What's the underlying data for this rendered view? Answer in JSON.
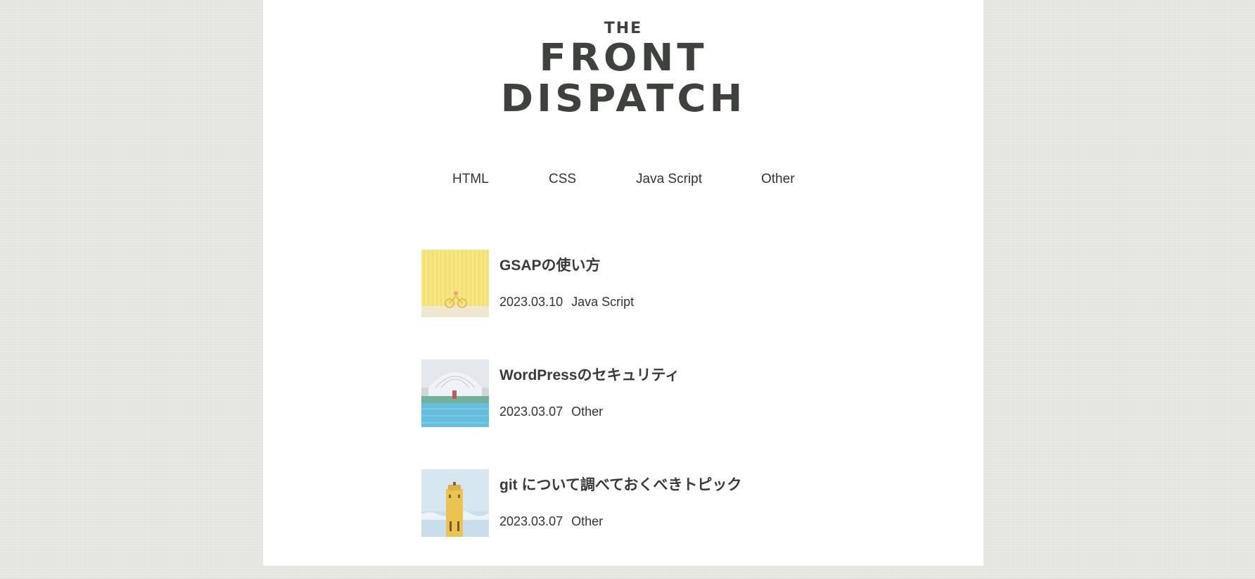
{
  "logo": {
    "the": "THE",
    "line1": "FRONT",
    "line2": "DISPATCH"
  },
  "nav": {
    "items": [
      {
        "label": "HTML"
      },
      {
        "label": "CSS"
      },
      {
        "label": "Java Script"
      },
      {
        "label": "Other"
      }
    ]
  },
  "posts": [
    {
      "title": "GSAPの使い方",
      "date": "2023.03.10",
      "category": "Java Script",
      "thumb": "yellow-wall-bicycle-image"
    },
    {
      "title": "WordPressのセキュリティ",
      "date": "2023.03.07",
      "category": "Other",
      "thumb": "indoor-pool-hall-image"
    },
    {
      "title": "git について調べておくべきトピック",
      "date": "2023.03.07",
      "category": "Other",
      "thumb": "yellow-tower-sky-image"
    }
  ],
  "colors": {
    "background": "#e8e8e2",
    "page": "#ffffff",
    "logo": "#3d433c",
    "text": "#333333"
  }
}
